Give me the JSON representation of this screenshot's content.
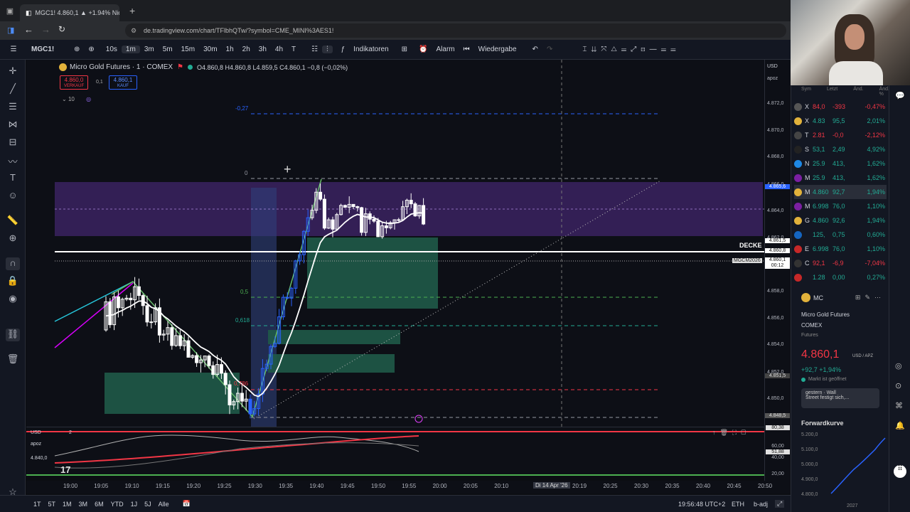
{
  "browser": {
    "tab_title": "MGC1! 4.860,1 ▲ +1.94% Nicht",
    "url": "de.tradingview.com/chart/TFlbhQTw/?symbol=CME_MINI%3AES1!"
  },
  "toolbar": {
    "symbol": "MGC1!",
    "intervals": [
      "10s",
      "1m",
      "3m",
      "5m",
      "15m",
      "30m",
      "1h",
      "2h",
      "3h",
      "4h",
      "T"
    ],
    "active_interval": "1m",
    "indicators_label": "Indikatoren",
    "alarm_label": "Alarm",
    "replay_label": "Wiedergabe"
  },
  "legend": {
    "title": "Micro Gold Futures · 1 · COMEX",
    "ohlc": "O4.860,8 H4.860,8 L4.859,5 C4.860,1 −0,8 (−0,02%)",
    "sell_price": "4.860,0",
    "sell_label": "VERKAUF",
    "spread": "0,1",
    "buy_price": "4.860,1",
    "buy_label": "KAUF",
    "indicator_count": "10"
  },
  "chart_labels": {
    "fib_top": "-0,27",
    "fib_zero": "0",
    "fib_half": "0,5",
    "fib_618": "0,618",
    "fib_786": "0,786",
    "resistance_label": "DECKE",
    "contract_label": "MGCM2026"
  },
  "price_scale": {
    "currency": "USD",
    "unit": "apoz",
    "ticks": [
      "4.872,0",
      "4.870,0",
      "4.868,0",
      "4.866,0",
      "4.864,0",
      "4.862,0",
      "4.858,0",
      "4.856,0",
      "4.854,0",
      "4.852,0",
      "4.850,0"
    ],
    "highlight_top": "4.865,6",
    "tag_a": "4.861,5",
    "tag_b": "4.860,8",
    "tag_c": "4.860,1",
    "tag_c_sub": "00:12",
    "tag_d": "4.851,5",
    "tag_e": "4.848,5"
  },
  "oscillator": {
    "currency": "USD",
    "unit": "apoz",
    "count": "2",
    "left_value": "4.840,0",
    "scale": [
      "80,38",
      "60,00",
      "51,88",
      "40,00",
      "20,00"
    ]
  },
  "time_axis": {
    "ticks": [
      "19:00",
      "19:05",
      "19:10",
      "19:15",
      "19:20",
      "19:25",
      "19:30",
      "19:35",
      "19:40",
      "19:45",
      "19:50",
      "19:55",
      "20:00",
      "20:05",
      "20:10",
      "20:19",
      "20:25",
      "20:30",
      "20:35",
      "20:40",
      "20:45",
      "20:50"
    ],
    "cursor_label": "Di 14 Apr '26"
  },
  "bottom_bar": {
    "ranges": [
      "1T",
      "5T",
      "1M",
      "3M",
      "6M",
      "YTD",
      "1J",
      "5J",
      "Alle"
    ],
    "clock": "19:56:48 UTC+2",
    "session": "ETH",
    "adj": "b-adj"
  },
  "watchlist": {
    "headers": [
      "Sym",
      "Letzt",
      "Änd.",
      "Änd. %"
    ],
    "rows": [
      {
        "sym": "X",
        "last": "84,0",
        "chg": "-393",
        "pct": "-0,47%",
        "color": "#f23645",
        "icon": "x"
      },
      {
        "sym": "X",
        "last": "4.83",
        "chg": "95,5",
        "pct": "2,01%",
        "color": "#22ab94",
        "icon": "gold"
      },
      {
        "sym": "T",
        "last": "2.81",
        "chg": "-0,0",
        "pct": "-2,12%",
        "color": "#f23645",
        "icon": "t"
      },
      {
        "sym": "S",
        "last": "53,1",
        "chg": "2,49",
        "pct": "4,92%",
        "color": "#22ab94",
        "icon": "s"
      },
      {
        "sym": "N",
        "last": "25.9",
        "chg": "413,",
        "pct": "1,62%",
        "color": "#22ab94",
        "icon": "n"
      },
      {
        "sym": "M",
        "last": "25.9",
        "chg": "413,",
        "pct": "1,62%",
        "color": "#22ab94",
        "icon": "m"
      },
      {
        "sym": "M",
        "last": "4.860",
        "chg": "92,7",
        "pct": "1,94%",
        "color": "#22ab94",
        "icon": "gold"
      },
      {
        "sym": "M",
        "last": "6.998",
        "chg": "76,0",
        "pct": "1,10%",
        "color": "#22ab94",
        "icon": "m"
      },
      {
        "sym": "G",
        "last": "4.860",
        "chg": "92,6",
        "pct": "1,94%",
        "color": "#22ab94",
        "icon": "gold"
      },
      {
        "sym": "",
        "last": "125,",
        "chg": "0,75",
        "pct": "0,60%",
        "color": "#22ab94",
        "icon": "blue"
      },
      {
        "sym": "E",
        "last": "6.998",
        "chg": "76,0",
        "pct": "1,10%",
        "color": "#22ab94",
        "icon": "red"
      },
      {
        "sym": "C",
        "last": "92,1",
        "chg": "-6,9",
        "pct": "-7,04%",
        "color": "#f23645",
        "icon": "c"
      },
      {
        "sym": "",
        "last": "1.28",
        "chg": "0,00",
        "pct": "0,27%",
        "color": "#22ab94",
        "icon": "red"
      }
    ]
  },
  "details": {
    "short": "MC",
    "name": "Micro Gold Futures",
    "exchange": "COMEX",
    "type": "Futures",
    "price": "4.860,1",
    "unit": "USD / APZ",
    "change": "+92,7 +1,94%",
    "market_status": "Markt ist geöffnet",
    "news_time": "gestern · Wall",
    "news_text": "Street festigt sich,...",
    "forward_title": "Forwardkurve",
    "forward_ticks": [
      "5.200,0",
      "5.100,0",
      "5.000,0",
      "4.900,0",
      "4.800,0"
    ],
    "forward_year": "2027"
  },
  "colors": {
    "up": "#22ab94",
    "down": "#f23645",
    "accent": "#2962ff",
    "zone_purple": "#4a2a6a",
    "zone_green": "#1f5a48"
  }
}
